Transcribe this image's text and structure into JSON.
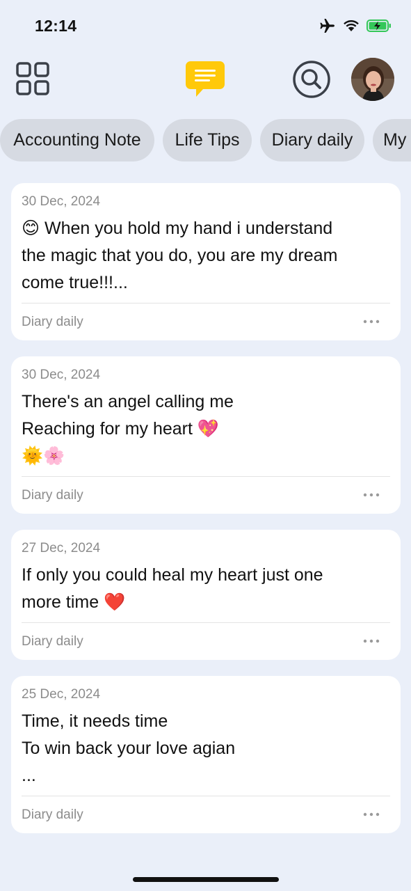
{
  "status_bar": {
    "time": "12:14"
  },
  "header": {
    "grid_icon": "grid-icon",
    "notes_icon": "chat-notes-icon",
    "search_icon": "search-icon",
    "accent_color": "#ffc90a"
  },
  "categories": [
    "Accounting Note",
    "Life Tips",
    "Diary daily",
    "My"
  ],
  "notes": [
    {
      "date": "30 Dec, 2024",
      "lines": [
        "😊 When you hold my hand i understand",
        "the magic that you do, you are my dream",
        "come true!!!..."
      ],
      "category": "Diary daily"
    },
    {
      "date": "30 Dec, 2024",
      "lines": [
        "There's an angel calling me",
        "Reaching for my heart 💖",
        "🌞🌸"
      ],
      "category": "Diary daily"
    },
    {
      "date": "27 Dec, 2024",
      "lines": [
        "If only you could heal my heart just one",
        "more time ❤️"
      ],
      "category": "Diary daily"
    },
    {
      "date": "25 Dec, 2024",
      "lines": [
        "Time, it needs time",
        "To win back your love agian",
        "..."
      ],
      "category": "Diary daily"
    }
  ]
}
